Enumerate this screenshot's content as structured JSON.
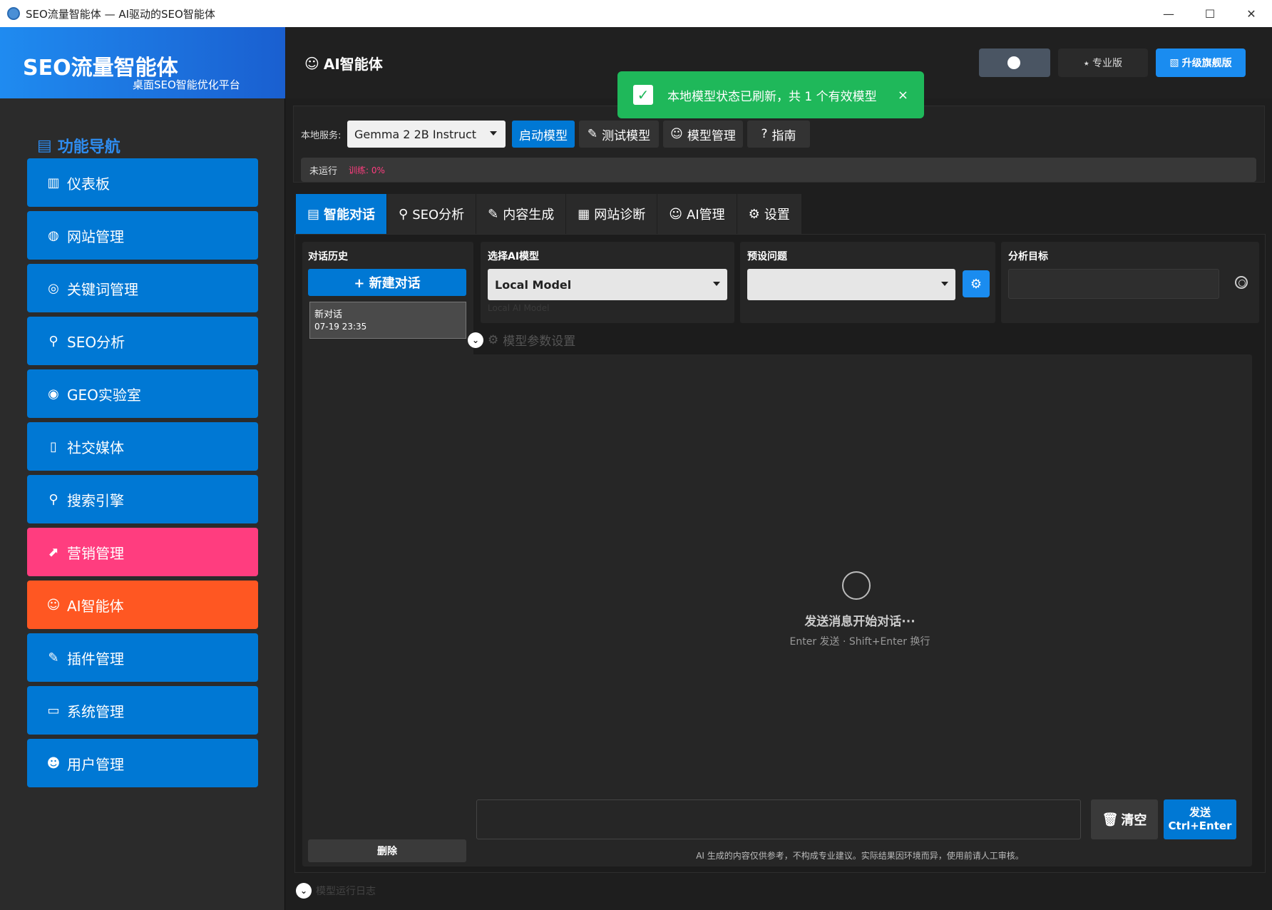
{
  "window": {
    "title": "SEO流量智能体 — AI驱动的SEO智能体",
    "controls": {
      "minimize": "—",
      "maximize": "☐",
      "close": "✕"
    }
  },
  "sidebar": {
    "brand_name": "SEO流量智能体",
    "brand_sub": "桌面SEO智能优化平台",
    "nav_title": "功能导航",
    "items": [
      {
        "label": "仪表板",
        "icon": "dashboard-icon",
        "glyph": "▥"
      },
      {
        "label": "网站管理",
        "icon": "globe-icon",
        "glyph": "◍"
      },
      {
        "label": "关键词管理",
        "icon": "target-icon",
        "glyph": "◎"
      },
      {
        "label": "SEO分析",
        "icon": "search-icon",
        "glyph": "⚲"
      },
      {
        "label": "GEO实验室",
        "icon": "earth-icon",
        "glyph": "◉"
      },
      {
        "label": "社交媒体",
        "icon": "phone-icon",
        "glyph": "▯"
      },
      {
        "label": "搜索引擎",
        "icon": "magnifier-icon",
        "glyph": "⚲"
      },
      {
        "label": "营销管理",
        "icon": "chart-icon",
        "glyph": "⬈"
      },
      {
        "label": "AI智能体",
        "icon": "robot-icon",
        "glyph": "☺"
      },
      {
        "label": "插件管理",
        "icon": "plugin-icon",
        "glyph": "✎"
      },
      {
        "label": "系统管理",
        "icon": "monitor-icon",
        "glyph": "▭"
      },
      {
        "label": "用户管理",
        "icon": "user-icon",
        "glyph": "☻"
      }
    ]
  },
  "header": {
    "title": "AI智能体",
    "edition": "⭑ 专业版",
    "upgrade_label": "升级旗舰版"
  },
  "toast": {
    "message": "本地模型状态已刷新，共 1 个有效模型",
    "close": "×"
  },
  "service": {
    "label": "本地服务:",
    "selected_model": "Gemma 2 2B Instruct",
    "start_btn": "启动模型",
    "test_btn": "测试模型",
    "manage_btn": "模型管理",
    "guide_btn": "指南",
    "status": "未运行",
    "training": "训练: 0%"
  },
  "tabs": [
    {
      "label": "智能对话",
      "icon": "chat-icon",
      "glyph": "▤"
    },
    {
      "label": "SEO分析",
      "icon": "search-icon",
      "glyph": "⚲"
    },
    {
      "label": "内容生成",
      "icon": "edit-icon",
      "glyph": "✎"
    },
    {
      "label": "网站诊断",
      "icon": "building-icon",
      "glyph": "▦"
    },
    {
      "label": "AI管理",
      "icon": "robot-icon",
      "glyph": "☺"
    },
    {
      "label": "设置",
      "icon": "gear-icon",
      "glyph": "⚙"
    }
  ],
  "history": {
    "label": "对话历史",
    "new_chat": "+ 新建对话",
    "items": [
      {
        "title": "新对话",
        "time": "07-19 23:35"
      }
    ],
    "delete": "删除"
  },
  "model_panel": {
    "label": "选择AI模型",
    "selected": "Local Model",
    "sub": "Local AI Model"
  },
  "preset_panel": {
    "label": "预设问题",
    "selected": ""
  },
  "target_panel": {
    "label": "分析目标",
    "value": ""
  },
  "params_toggle": "模型参数设置",
  "chat": {
    "empty_title": "发送消息开始对话···",
    "empty_hint": "Enter 发送 · Shift+Enter 换行",
    "input_placeholder": "",
    "clear_btn": "清空",
    "send_btn_line1": "发送",
    "send_btn_line2": "Ctrl+Enter",
    "disclaimer": "AI 生成的内容仅供参考，不构成专业建议。实际结果因环境而异，使用前请人工审核。"
  },
  "log_toggle": "模型运行日志",
  "colors": {
    "accent": "#0078d4",
    "pink": "#ff3d7f",
    "orange": "#ff5722",
    "toast": "#1fb85a"
  }
}
